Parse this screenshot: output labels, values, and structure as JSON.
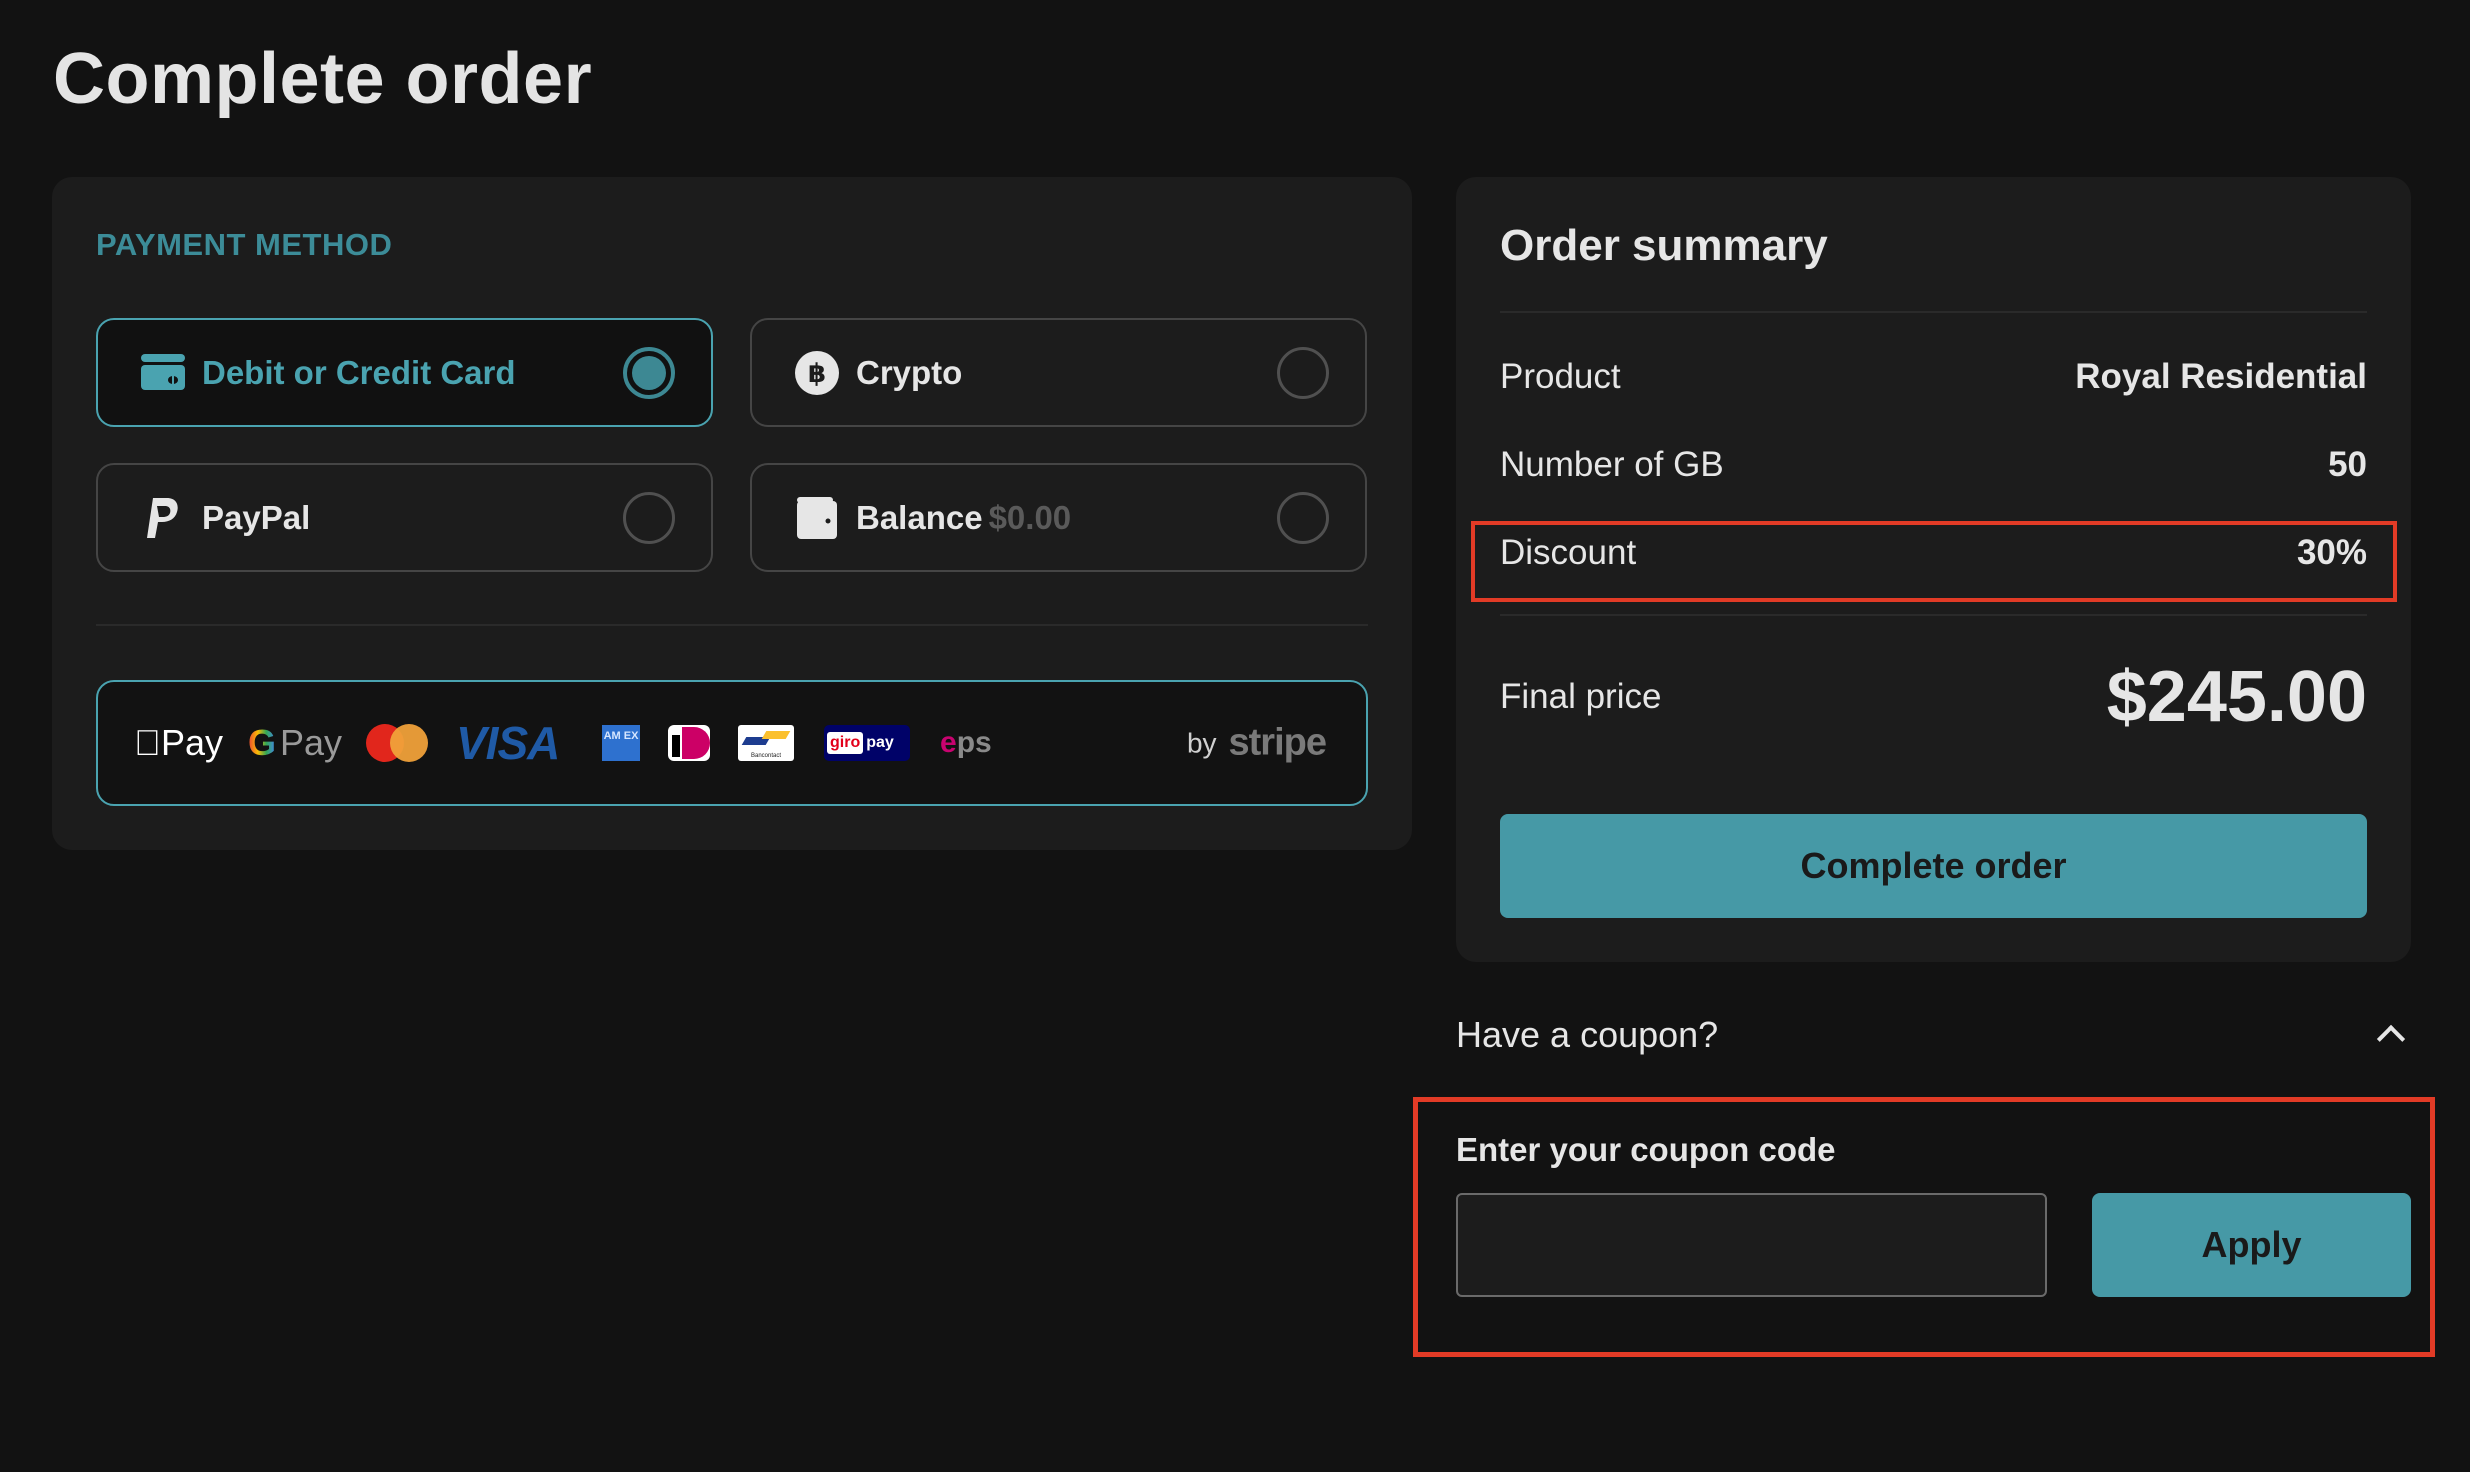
{
  "page": {
    "title": "Complete order"
  },
  "payment": {
    "section_label": "PAYMENT METHOD",
    "options": [
      {
        "id": "card",
        "label": "Debit or Credit Card",
        "icon": "credit-card-icon",
        "selected": true
      },
      {
        "id": "crypto",
        "label": "Crypto",
        "icon": "bitcoin-icon",
        "selected": false
      },
      {
        "id": "paypal",
        "label": "PayPal",
        "icon": "paypal-icon",
        "selected": false
      },
      {
        "id": "balance",
        "label": "Balance",
        "sub": "$0.00",
        "icon": "wallet-icon",
        "selected": false
      }
    ],
    "logos": {
      "apple_pay": "Pay",
      "google_pay_g": "G",
      "google_pay": "Pay",
      "visa": "VISA",
      "amex": "AM EX",
      "bancontact": "Bancontact",
      "giropay_giro": "giro",
      "giropay_pay": "pay",
      "eps_e": "e",
      "eps": "ps",
      "by": "by",
      "stripe": "stripe"
    }
  },
  "summary": {
    "title": "Order summary",
    "rows": [
      {
        "label": "Product",
        "value": "Royal Residential"
      },
      {
        "label": "Number of GB",
        "value": "50"
      },
      {
        "label": "Discount",
        "value": "30%"
      }
    ],
    "final_label": "Final price",
    "final_value": "$245.00",
    "complete_button": "Complete order",
    "highlight_color": "#e23b26"
  },
  "coupon": {
    "toggle_label": "Have a coupon?",
    "expanded": true,
    "field_label": "Enter your coupon code",
    "value": "",
    "placeholder": "",
    "apply_button": "Apply"
  },
  "colors": {
    "accent": "#4699a6",
    "background": "#121212",
    "panel": "#1c1c1c",
    "annotation": "#e23b26"
  }
}
